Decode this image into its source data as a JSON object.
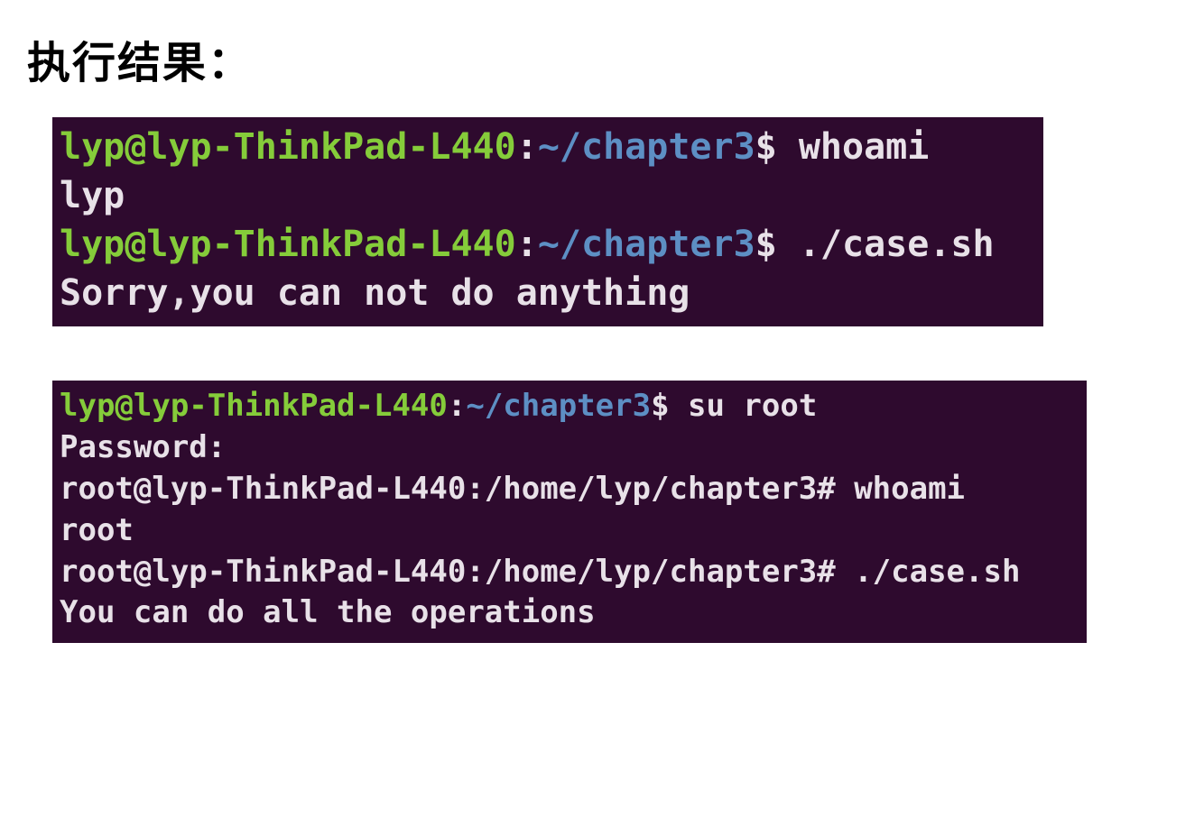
{
  "heading": "执行结果：",
  "terminal1": {
    "line1": {
      "userhost": "lyp@lyp-ThinkPad-L440",
      "colon": ":",
      "path": "~/chapter3",
      "prompt": "$ ",
      "cmd": "whoami"
    },
    "line2": "lyp",
    "line3": {
      "userhost": "lyp@lyp-ThinkPad-L440",
      "colon": ":",
      "path": "~/chapter3",
      "prompt": "$ ",
      "cmd": "./case.sh"
    },
    "line4": "Sorry,you can not do anything"
  },
  "terminal2": {
    "line1": {
      "userhost": "lyp@lyp-ThinkPad-L440",
      "colon": ":",
      "path": "~/chapter3",
      "prompt": "$ ",
      "cmd": "su root"
    },
    "line2": "Password:",
    "line3": "root@lyp-ThinkPad-L440:/home/lyp/chapter3# whoami",
    "line4": "root",
    "line5": "root@lyp-ThinkPad-L440:/home/lyp/chapter3# ./case.sh",
    "line6": "You can do all the operations"
  }
}
